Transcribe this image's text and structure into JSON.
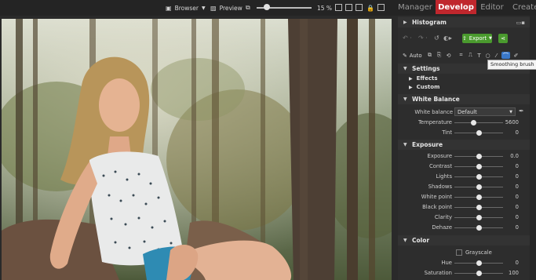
{
  "toolbar": {
    "browser_label": "Browser",
    "preview_label": "Preview",
    "zoom_value": "15 %",
    "zoom_fraction": 0.19
  },
  "modes": {
    "manager": "Manager",
    "develop": "Develop",
    "editor": "Editor",
    "create": "Create"
  },
  "panel": {
    "histogram_title": "Histogram",
    "export_label": "Export",
    "auto_label": "Auto",
    "tooltip": "Smoothing brush (U)",
    "settings_title": "Settings",
    "effects_title": "Effects",
    "custom_title": "Custom",
    "white_balance": {
      "title": "White Balance",
      "wb_label": "White balance",
      "wb_value": "Default",
      "rows": [
        {
          "label": "Temperature",
          "value": "5600",
          "level": 0.4
        },
        {
          "label": "Tint",
          "value": "0",
          "level": 0.5
        }
      ]
    },
    "exposure": {
      "title": "Exposure",
      "rows": [
        {
          "label": "Exposure",
          "value": "0.0",
          "level": 0.5
        },
        {
          "label": "Contrast",
          "value": "0",
          "level": 0.5
        },
        {
          "label": "Lights",
          "value": "0",
          "level": 0.5
        },
        {
          "label": "Shadows",
          "value": "0",
          "level": 0.5
        },
        {
          "label": "White point",
          "value": "0",
          "level": 0.5
        },
        {
          "label": "Black point",
          "value": "0",
          "level": 0.5
        },
        {
          "label": "Clarity",
          "value": "0",
          "level": 0.5
        },
        {
          "label": "Dehaze",
          "value": "0",
          "level": 0.5
        }
      ]
    },
    "color": {
      "title": "Color",
      "grayscale_label": "Grayscale",
      "rows": [
        {
          "label": "Hue",
          "value": "0",
          "level": 0.5
        },
        {
          "label": "Saturation",
          "value": "100",
          "level": 0.5
        }
      ]
    }
  },
  "colors": {
    "accent": "#c0272d",
    "export_green": "#4a9a2e",
    "active_tool": "#3a78c8"
  }
}
